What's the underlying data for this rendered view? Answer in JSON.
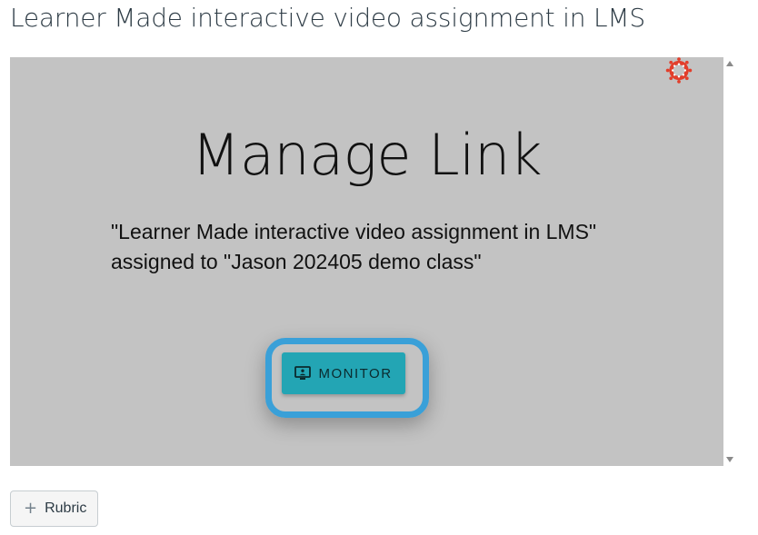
{
  "page": {
    "title": "Learner Made interactive video assignment in LMS"
  },
  "frame": {
    "heading": "Manage Link",
    "assignment_line1": "\"Learner Made interactive video assignment in LMS\"",
    "assignment_line2": "assigned to \"Jason 202405 demo class\"",
    "monitor_button": {
      "label": "MONITOR",
      "icon": "monitor-screen-icon",
      "color": "#23a5b4",
      "highlight_color": "#3aa0d8"
    },
    "logo": {
      "icon": "canvas-lms-logo",
      "color": "#e23e2b"
    }
  },
  "footer": {
    "rubric_button": {
      "label": "Rubric",
      "icon": "plus-icon"
    }
  }
}
